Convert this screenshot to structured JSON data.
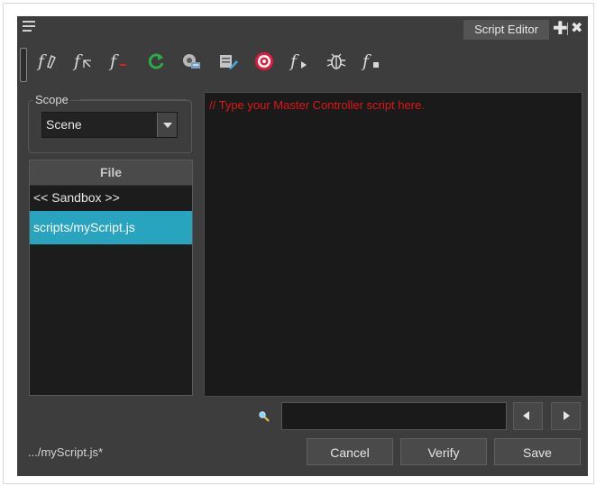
{
  "window": {
    "tab_title": "Script Editor",
    "plus_glyph": "✚",
    "close_glyph": "✖"
  },
  "toolbar": [
    {
      "name": "new-function-icon",
      "glyph": "f∅"
    },
    {
      "name": "rename-function-icon",
      "glyph": "fₖ"
    },
    {
      "name": "delete-function-icon",
      "glyph": "f"
    },
    {
      "name": "refresh-icon",
      "glyph": "⟳"
    },
    {
      "name": "import-script-icon",
      "glyph": ""
    },
    {
      "name": "edit-script-icon",
      "glyph": ""
    },
    {
      "name": "target-icon",
      "glyph": "◎"
    },
    {
      "name": "run-function-icon",
      "glyph": "f▸"
    },
    {
      "name": "debug-icon",
      "glyph": "✲"
    },
    {
      "name": "stop-function-icon",
      "glyph": "f■"
    }
  ],
  "scope": {
    "label": "Scope",
    "value": "Scene"
  },
  "file_list": {
    "header": "File",
    "items": [
      "<< Sandbox >>",
      "scripts/myScript.js"
    ],
    "selected_index": 1
  },
  "editor": {
    "text": "// Type your Master Controller script here."
  },
  "status": {
    "file": ".../myScript.js*"
  },
  "buttons": {
    "cancel": "Cancel",
    "verify": "Verify",
    "save": "Save"
  },
  "colors": {
    "panel_bg": "#3d3d3d",
    "editor_bg": "#1a1a1a",
    "selection": "#29a4bf",
    "code_text": "#e01515"
  }
}
